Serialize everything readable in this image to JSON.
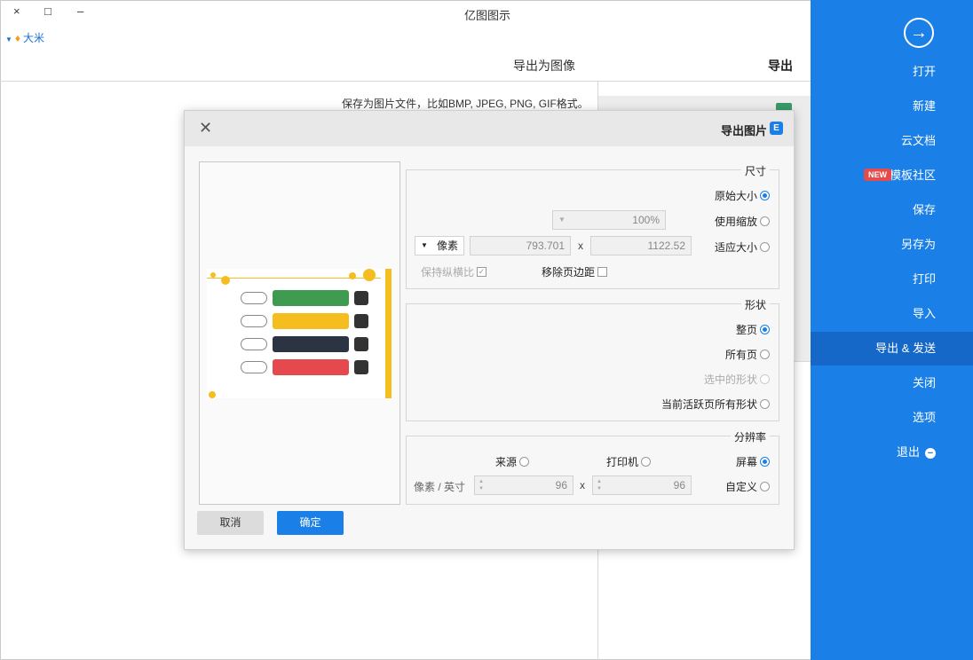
{
  "app": {
    "title": "亿图图示",
    "user_name": "大米"
  },
  "window_controls": [
    "×",
    "□",
    "–"
  ],
  "header": {
    "export_label": "导出",
    "export_image_label": "导出为图像",
    "description": "保存为图片文件，比如BMP, JPEG, PNG, GIF格式。"
  },
  "sidebar": {
    "items": [
      {
        "label": "打开"
      },
      {
        "label": "新建"
      },
      {
        "label": "云文档"
      },
      {
        "label": "模板社区",
        "badge": "NEW"
      },
      {
        "label": "保存"
      },
      {
        "label": "另存为"
      },
      {
        "label": "打印"
      },
      {
        "label": "导入"
      },
      {
        "label": "导出 & 发送",
        "active": true
      },
      {
        "label": "关闭"
      },
      {
        "label": "选项"
      },
      {
        "label": "退出"
      }
    ]
  },
  "dialog": {
    "title": "导出图片",
    "size": {
      "title": "尺寸",
      "original_size": "原始大小",
      "use_zoom": "使用缩放",
      "zoom_value": "100%",
      "fit_size": "适应大小",
      "width": "1122.52",
      "height": "793.701",
      "unit": "像素",
      "remove_margin": "移除页边距",
      "keep_ratio": "保持纵横比"
    },
    "shape": {
      "title": "形状",
      "whole_page": "整页",
      "all_pages": "所有页",
      "selected_shapes": "选中的形状",
      "current_active_page_shapes": "当前活跃页所有形状"
    },
    "resolution": {
      "title": "分辨率",
      "screen": "屏幕",
      "printer": "打印机",
      "source": "来源",
      "custom": "自定义",
      "dpi_x": "96",
      "dpi_y": "96",
      "unit": "像素 / 英寸"
    },
    "ok_label": "确定",
    "cancel_label": "取消"
  },
  "colors": {
    "sidebar_blue": "#1a7fe6",
    "preview_green": "#3f9b4f",
    "preview_yellow": "#f5bd1e",
    "preview_dark": "#2c3443",
    "preview_red": "#e5484d"
  }
}
